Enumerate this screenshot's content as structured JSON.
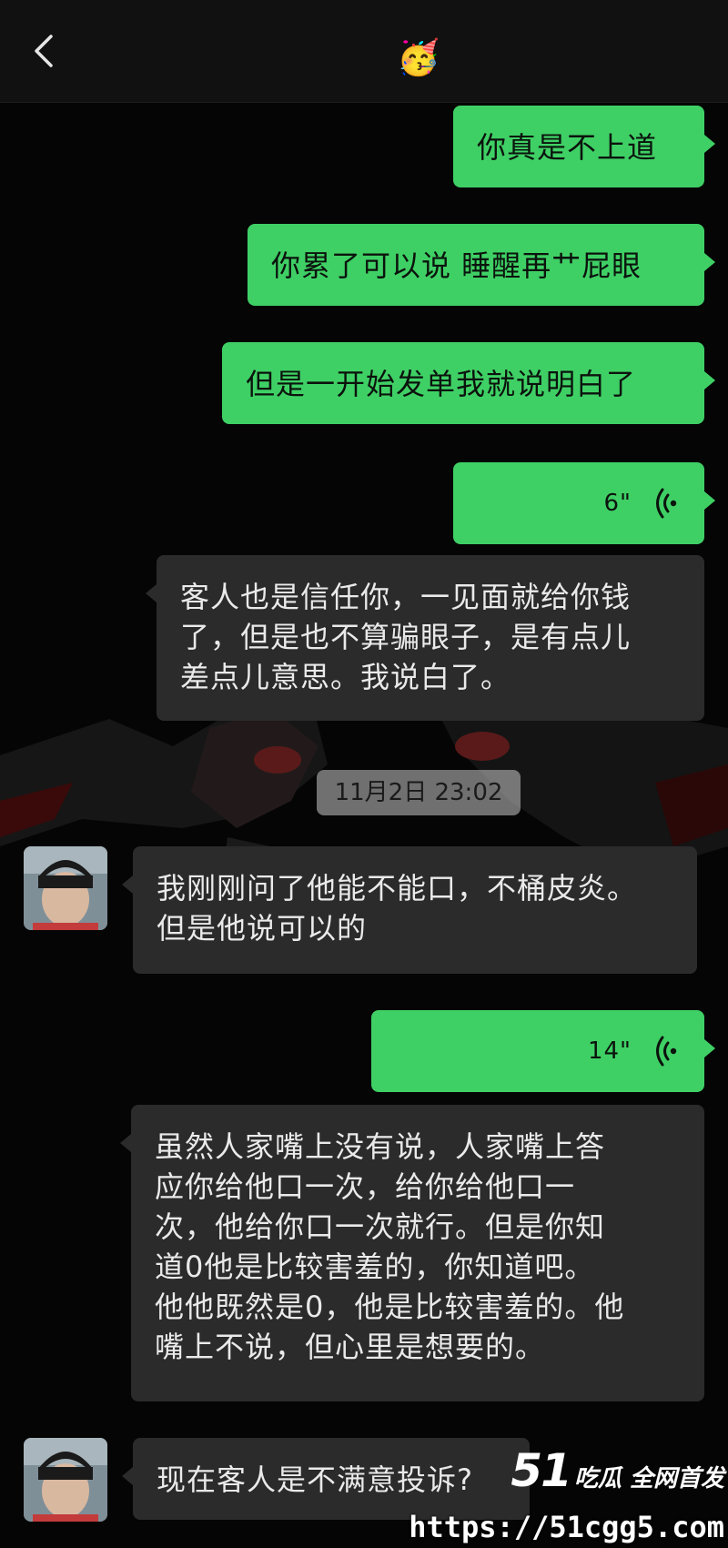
{
  "header": {
    "back_icon": "chevron-left-icon",
    "title_emoji": "🥳"
  },
  "messages": [
    {
      "id": "m1",
      "direction": "outgoing",
      "type": "text",
      "text": "你真是不上道"
    },
    {
      "id": "m2",
      "direction": "outgoing",
      "type": "text",
      "text": "你累了可以说 睡醒再艹屁眼"
    },
    {
      "id": "m3",
      "direction": "outgoing",
      "type": "text",
      "text": "但是一开始发单我就说明白了"
    },
    {
      "id": "m4",
      "direction": "outgoing",
      "type": "voice",
      "duration": "6\""
    },
    {
      "id": "m5",
      "direction": "incoming",
      "type": "text",
      "lines": [
        "客人也是信任你，一见面就给你钱",
        "了，但是也不算骗眼子，是有点儿",
        "差点儿意思。我说白了。"
      ]
    },
    {
      "id": "m6",
      "direction": "incoming",
      "type": "text",
      "avatar": true,
      "lines": [
        "我刚刚问了他能不能口，不桶皮炎。",
        "但是他说可以的"
      ]
    },
    {
      "id": "m7",
      "direction": "outgoing",
      "type": "voice",
      "duration": "14\""
    },
    {
      "id": "m8",
      "direction": "incoming",
      "type": "text",
      "lines": [
        "虽然人家嘴上没有说，人家嘴上答",
        "应你给他口一次，给你给他口一",
        "次，他给你口一次就行。但是你知",
        "道0他是比较害羞的，你知道吧。",
        "他他既然是0，他是比较害羞的。他",
        "嘴上不说，但心里是想要的。"
      ]
    },
    {
      "id": "m9",
      "direction": "incoming",
      "type": "text",
      "avatar": true,
      "text": "现在客人是不满意投诉?"
    }
  ],
  "timestamp": "11月2日 23:02",
  "watermark": {
    "brand_number": "51",
    "brand_text": "吃瓜 全网首发",
    "url": "https://51cgg5.com"
  },
  "colors": {
    "outgoing_bubble": "#3fd065",
    "incoming_bubble": "#2b2b2b",
    "background": "#050505"
  }
}
